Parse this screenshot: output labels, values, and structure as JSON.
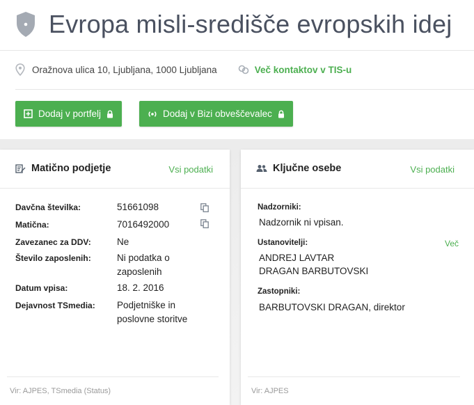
{
  "header": {
    "title": "Evropa misli-središče evropskih idej",
    "address": "Oražnova ulica 10, Ljubljana, 1000 Ljubljana",
    "more_contacts": "Več kontaktov v TIS-u",
    "buttons": {
      "portfolio": "Dodaj v portfelj",
      "bizi": "Dodaj v Bizi obveščevalec"
    }
  },
  "company_card": {
    "title": "Matično podjetje",
    "link": "Vsi podatki",
    "rows": [
      {
        "label": "Davčna številka:",
        "value": "51661098"
      },
      {
        "label": "Matična:",
        "value": "7016492000"
      },
      {
        "label": "Zavezanec za DDV:",
        "value": "Ne"
      },
      {
        "label": "Število zaposlenih:",
        "value": "Ni podatka o zaposlenih"
      },
      {
        "label": "Datum vpisa:",
        "value": "18. 2. 2016"
      },
      {
        "label": "Dejavnost TSmedia:",
        "value": "Podjetniške in poslovne storitve"
      }
    ],
    "source": "Vir: AJPES, TSmedia (Status)"
  },
  "people_card": {
    "title": "Ključne osebe",
    "link": "Vsi podatki",
    "supervisors_label": "Nadzorniki:",
    "supervisors_value": "Nadzornik ni vpisan.",
    "founders_label": "Ustanovitelji:",
    "founders_more": "Več",
    "founders": [
      "ANDREJ LAVTAR",
      "DRAGAN BARBUTOVSKI"
    ],
    "representatives_label": "Zastopniki:",
    "representative": "BARBUTOVSKI DRAGAN",
    "representative_role": ", direktor",
    "source": "Vir: AJPES"
  },
  "colors": {
    "accent": "#4caf50",
    "title": "#4a5160",
    "background": "#ececec"
  }
}
